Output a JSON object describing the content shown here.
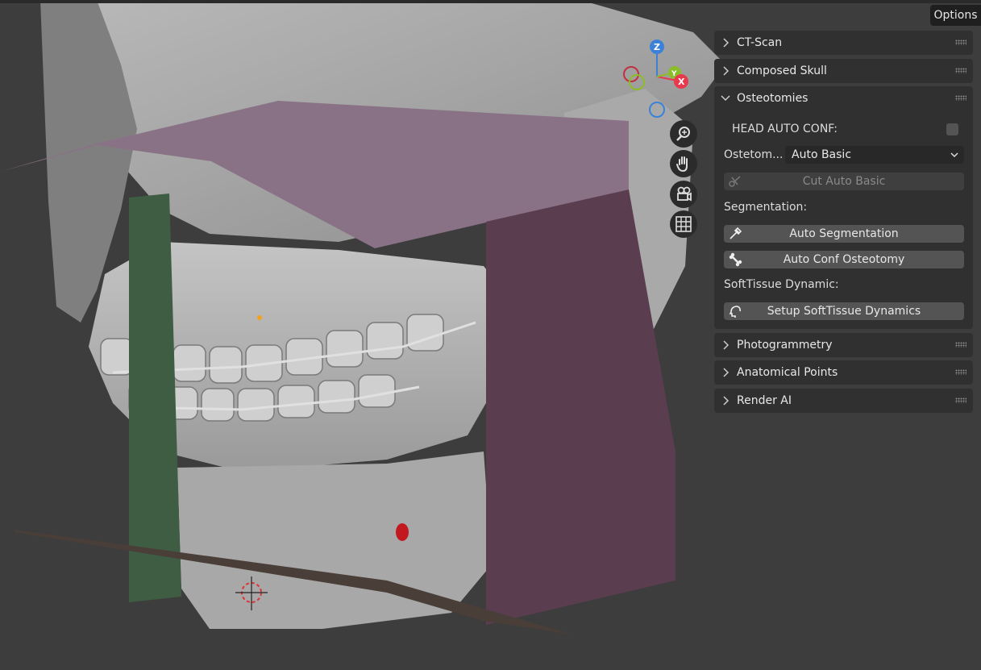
{
  "header": {
    "options_label": "Options"
  },
  "gizmo": {
    "z": "Z",
    "y": "Y",
    "x": "X"
  },
  "nav_icons": [
    "zoom-icon",
    "hand-pan-icon",
    "camera-icon",
    "grid-icon"
  ],
  "colors": {
    "axis_x": "#e8394d",
    "axis_y": "#8bbd28",
    "axis_z": "#3b82d6",
    "panel_bg": "#303030",
    "button_bg": "#545454"
  },
  "panels": {
    "ct_scan": "CT-Scan",
    "composed_skull": "Composed Skull",
    "osteotomies": {
      "title": "Osteotomies",
      "head_auto_conf_label": "HEAD AUTO CONF:",
      "head_auto_conf_checked": false,
      "osteotomy_label": "Ostetom...",
      "osteotomy_value": "Auto Basic",
      "cut_button": "Cut Auto Basic",
      "segmentation_label": "Segmentation:",
      "auto_segmentation_button": "Auto Segmentation",
      "auto_conf_osteotomy_button": "Auto Conf Osteotomy",
      "softtissue_label": "SoftTissue Dynamic:",
      "setup_softtissue_button": "Setup SoftTissue Dynamics"
    },
    "photogrammetry": "Photogrammetry",
    "anatomical_points": "Anatomical Points",
    "render_ai": "Render AI"
  }
}
